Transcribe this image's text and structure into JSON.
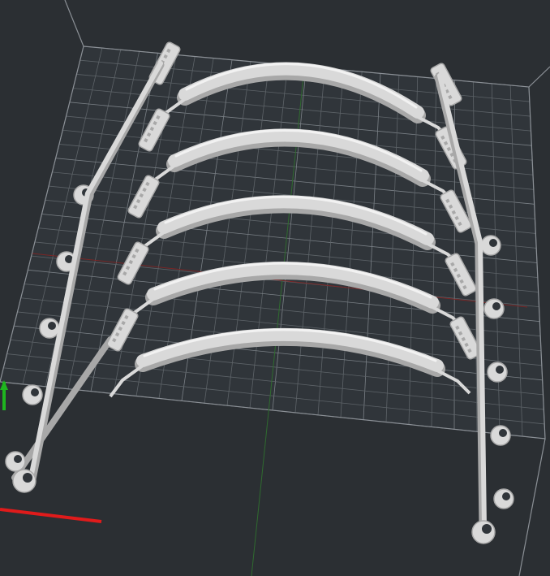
{
  "viewport": {
    "background": "#2b2f33",
    "bed_color": "#30353a",
    "grid_color": "#5d6368",
    "grid_major_color": "#7a8086",
    "edge_color": "#8b9096"
  },
  "axes": {
    "x_color": "#e01b1b",
    "y_color": "#1fb51f",
    "x_label": "",
    "y_label": ""
  },
  "model": {
    "part_count": 5,
    "color": "#d9d9d9",
    "shade": "#a8a8a8",
    "highlight": "#f2f2f2"
  }
}
